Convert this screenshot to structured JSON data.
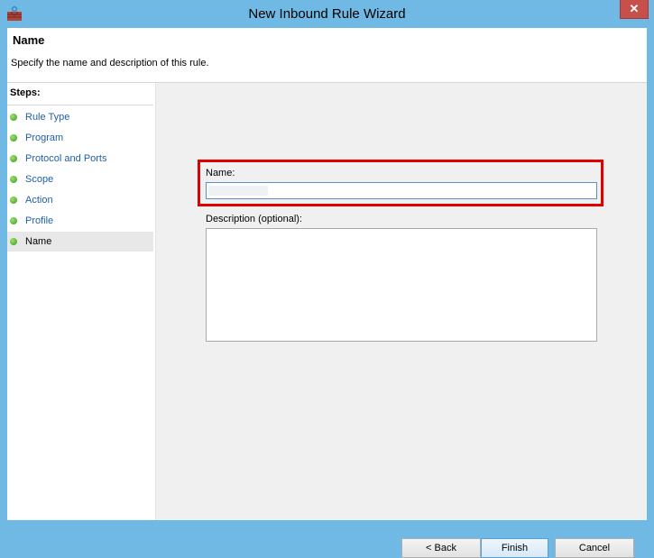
{
  "window": {
    "title": "New Inbound Rule Wizard",
    "close_glyph": "✕",
    "app_icon": "firewall-icon"
  },
  "header": {
    "title": "Name",
    "subtitle": "Specify the name and description of this rule."
  },
  "steps": {
    "title": "Steps:",
    "items": [
      {
        "label": "Rule Type"
      },
      {
        "label": "Program"
      },
      {
        "label": "Protocol and Ports"
      },
      {
        "label": "Scope"
      },
      {
        "label": "Action"
      },
      {
        "label": "Profile"
      },
      {
        "label": "Name"
      }
    ],
    "current": "Name"
  },
  "form": {
    "name_label": "Name:",
    "name_value": "",
    "description_label": "Description (optional):",
    "description_value": ""
  },
  "buttons": {
    "back": "< Back",
    "finish": "Finish",
    "cancel": "Cancel"
  },
  "colors": {
    "titlebar": "#6fb9e4",
    "highlight": "#e00000",
    "link": "#1f5fa8",
    "close": "#c7514a"
  }
}
